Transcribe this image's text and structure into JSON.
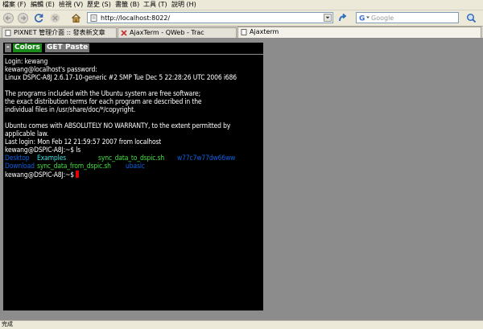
{
  "menu": [
    {
      "label": "檔案 (F)"
    },
    {
      "label": "編輯 (E)"
    },
    {
      "label": "檢視 (V)"
    },
    {
      "label": "歷史 (S)"
    },
    {
      "label": "書籤 (B)"
    },
    {
      "label": "工具 (T)"
    },
    {
      "label": "說明 (H)"
    }
  ],
  "nav": {
    "url": "http://localhost:8022/",
    "search_placeholder": "Google"
  },
  "tabs": [
    {
      "label": "PIXNET 管理介面 :: 發表新文章",
      "active": false
    },
    {
      "label": "AjaxTerm - QWeb - Trac",
      "active": false
    },
    {
      "label": "Ajaxterm",
      "active": true
    }
  ],
  "terminal": {
    "toolbar": {
      "close": "-",
      "colors": "Colors",
      "get": "GET",
      "paste": "Paste"
    },
    "lines": [
      "Login: kewang",
      "kewang@localhost's password:",
      "Linux DSPIC-A8J 2.6.17-10-generic #2 SMP Tue Dec 5 22:28:26 UTC 2006 i686",
      "",
      "The programs included with the Ubuntu system are free software;",
      "the exact distribution terms for each program are described in the",
      "individual files in /usr/share/doc/*/copyright.",
      "",
      "Ubuntu comes with ABSOLUTELY NO WARRANTY, to the extent permitted by",
      "applicable law.",
      "Last login: Mon Feb 12 21:59:57 2007 from localhost",
      "kewang@DSPIC-A8J:~$ ls"
    ],
    "ls": {
      "row1": [
        "Desktop",
        "Examples",
        "sync_data_to_dspic.sh",
        "w77c7w77dw66ww"
      ],
      "row2": [
        "Download",
        "sync_data_from_dspic.sh",
        "ubasic"
      ]
    },
    "prompt": "kewang@DSPIC-A8J:~$ "
  },
  "status": {
    "text": "完成"
  },
  "colors": {
    "terminal_bg": "#000000",
    "dir_blue": "#1060e0",
    "link_cyan": "#40e0e0",
    "exec_green": "#40e040",
    "colors_btn": "#1a8a1a",
    "cursor": "#e00000"
  }
}
